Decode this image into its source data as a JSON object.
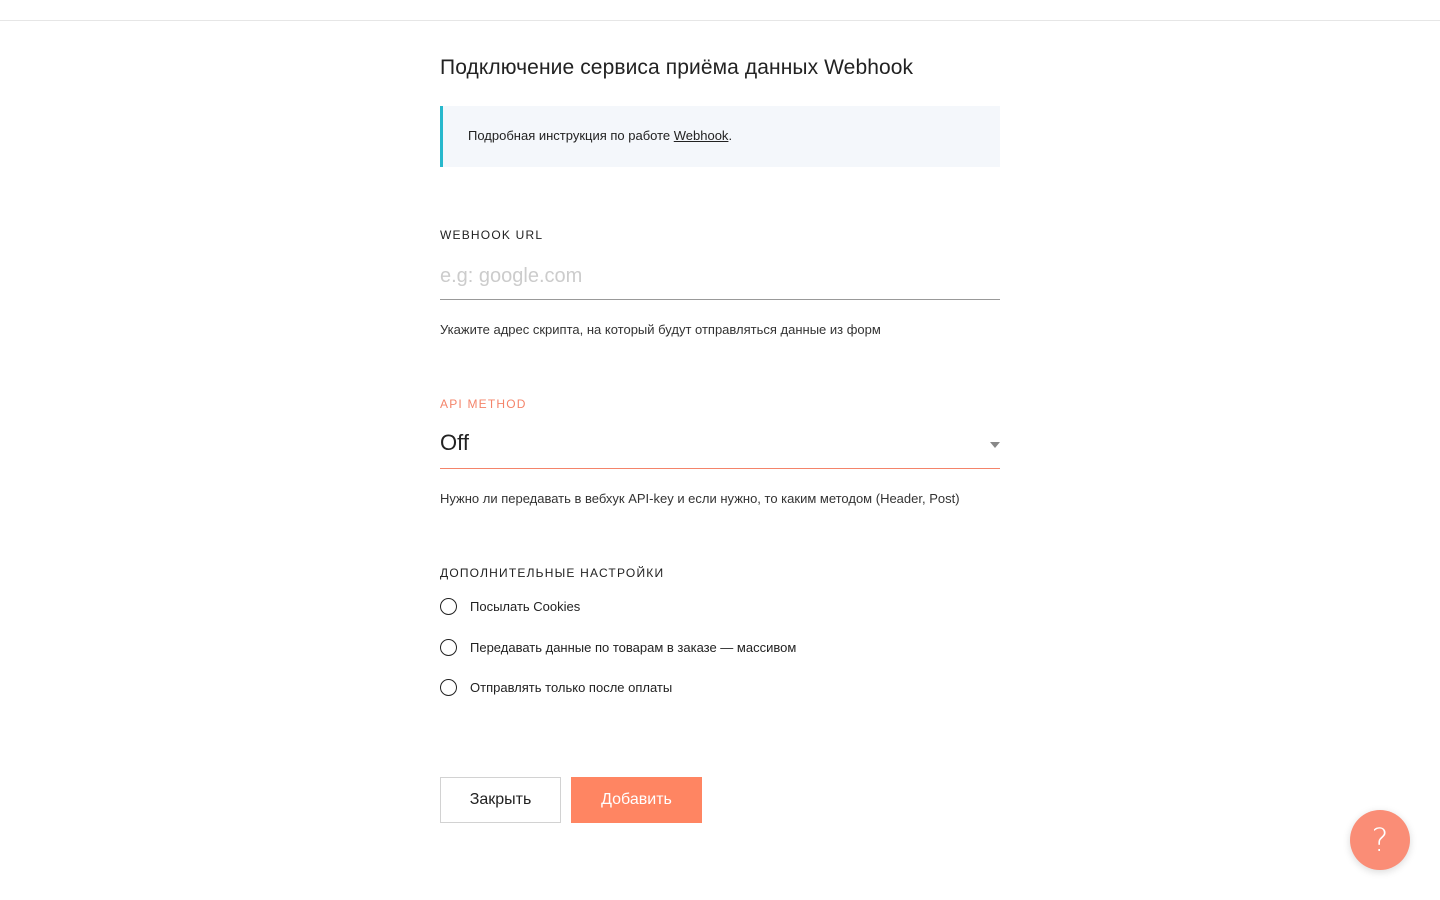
{
  "page": {
    "title": "Подключение сервиса приёма данных Webhook"
  },
  "info": {
    "text": "Подробная инструкция по работе ",
    "link_label": "Webhook",
    "suffix": "."
  },
  "webhook_url": {
    "label": "WEBHOOK URL",
    "placeholder": "e.g: google.com",
    "value": "",
    "hint": "Укажите адрес скрипта, на который будут отправляться данные из форм"
  },
  "api_method": {
    "label": "API METHOD",
    "selected": "Off",
    "hint": "Нужно ли передавать в вебхук API-key и если нужно, то каким методом (Header, Post)"
  },
  "extra_settings": {
    "label": "ДОПОЛНИТЕЛЬНЫЕ НАСТРОЙКИ",
    "options": [
      {
        "label": "Посылать Cookies",
        "checked": false
      },
      {
        "label": "Передавать данные по товарам в заказе — массивом",
        "checked": false
      },
      {
        "label": "Отправлять только после оплаты",
        "checked": false
      }
    ]
  },
  "actions": {
    "close_label": "Закрыть",
    "add_label": "Добавить"
  },
  "help": {
    "icon": "question-icon",
    "glyph": "?"
  },
  "colors": {
    "accent": "#ff8562",
    "info_border": "#27b8cc",
    "info_bg": "#f4f7fb"
  }
}
